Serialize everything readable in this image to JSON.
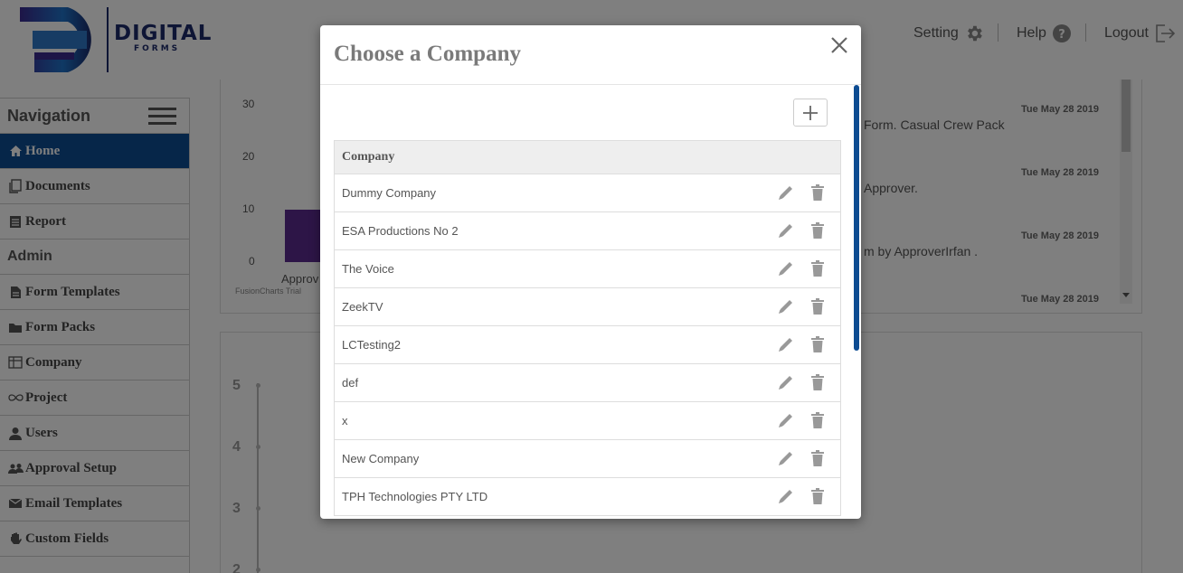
{
  "header": {
    "brand_line1": "DIGITAL",
    "brand_line2": "FORMS",
    "setting_label": "Setting",
    "help_label": "Help",
    "logout_label": "Logout"
  },
  "sidebar": {
    "title": "Navigation",
    "items": [
      {
        "label": "Home",
        "icon": "home-icon",
        "active": true
      },
      {
        "label": "Documents",
        "icon": "documents-icon"
      },
      {
        "label": "Report",
        "icon": "report-icon"
      },
      {
        "label": "Admin",
        "section": true
      },
      {
        "label": "Form Templates",
        "icon": "file-icon"
      },
      {
        "label": "Form Packs",
        "icon": "folder-icon"
      },
      {
        "label": "Company",
        "icon": "building-icon"
      },
      {
        "label": "Project",
        "icon": "infinity-icon"
      },
      {
        "label": "Users",
        "icon": "user-icon"
      },
      {
        "label": "Approval Setup",
        "icon": "users-icon"
      },
      {
        "label": "Email Templates",
        "icon": "envelope-icon"
      },
      {
        "label": "Custom Fields",
        "icon": "hand-icon"
      }
    ]
  },
  "dashboard": {
    "chart_data": {
      "type": "bar",
      "categories": [
        "Approv"
      ],
      "values": [
        10
      ],
      "ylim": [
        0,
        30
      ],
      "yticks": [
        "30",
        "20",
        "10",
        "0"
      ],
      "watermark": "FusionCharts Trial"
    },
    "activity": [
      {
        "text": "Form. Casual Crew Pack",
        "date": "Tue May 28 2019"
      },
      {
        "text": "Approver.",
        "date": "Tue May 28 2019"
      },
      {
        "text": "m by ApproverIrfan .",
        "date": "Tue May 28 2019"
      },
      {
        "text": "",
        "date": "Tue May 28 2019"
      }
    ],
    "chart2_yticks": [
      "5",
      "4",
      "3",
      "2"
    ]
  },
  "modal": {
    "title": "Choose a Company",
    "column_header": "Company",
    "companies": [
      "Dummy Company",
      "ESA Productions No 2",
      "The Voice",
      "ZeekTV",
      "LCTesting2",
      "def",
      "x",
      "New Company",
      "TPH Technologies PTY LTD"
    ]
  },
  "colors": {
    "primary": "#0d4c92",
    "bar": "#5b2b8f"
  }
}
